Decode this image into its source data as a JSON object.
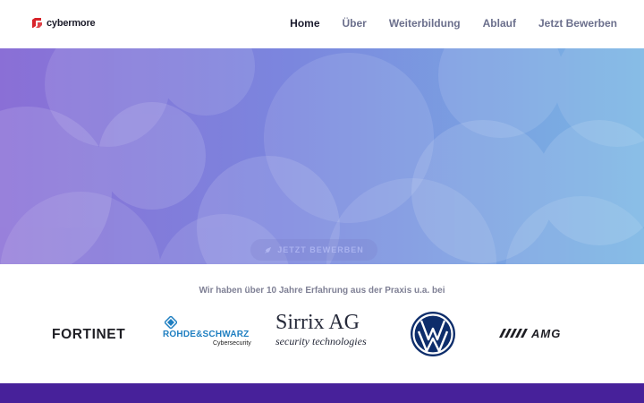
{
  "brand": {
    "name": "cybermore",
    "accent": "#d8232a"
  },
  "nav": {
    "items": [
      {
        "label": "Home",
        "active": true
      },
      {
        "label": "Über",
        "active": false
      },
      {
        "label": "Weiterbildung",
        "active": false
      },
      {
        "label": "Ablauf",
        "active": false
      },
      {
        "label": "Jetzt Bewerben",
        "active": false
      }
    ]
  },
  "hero": {
    "cta_label": "JETZT BEWERBEN",
    "cta_icon": "rocket-icon",
    "colors": {
      "left": "#8a6fd6",
      "right": "#7ab6e4"
    }
  },
  "partners": {
    "title": "Wir haben über 10 Jahre Erfahrung aus der Praxis u.a. bei",
    "logos": [
      {
        "name": "FORTINET"
      },
      {
        "name": "ROHDE&SCHWARZ",
        "sub": "Cybersecurity"
      },
      {
        "name": "Sirrix AG",
        "sub": "security technologies"
      },
      {
        "name": "Volkswagen"
      },
      {
        "name": "AMG"
      }
    ]
  },
  "footer_band": {
    "color": "#47219a"
  }
}
